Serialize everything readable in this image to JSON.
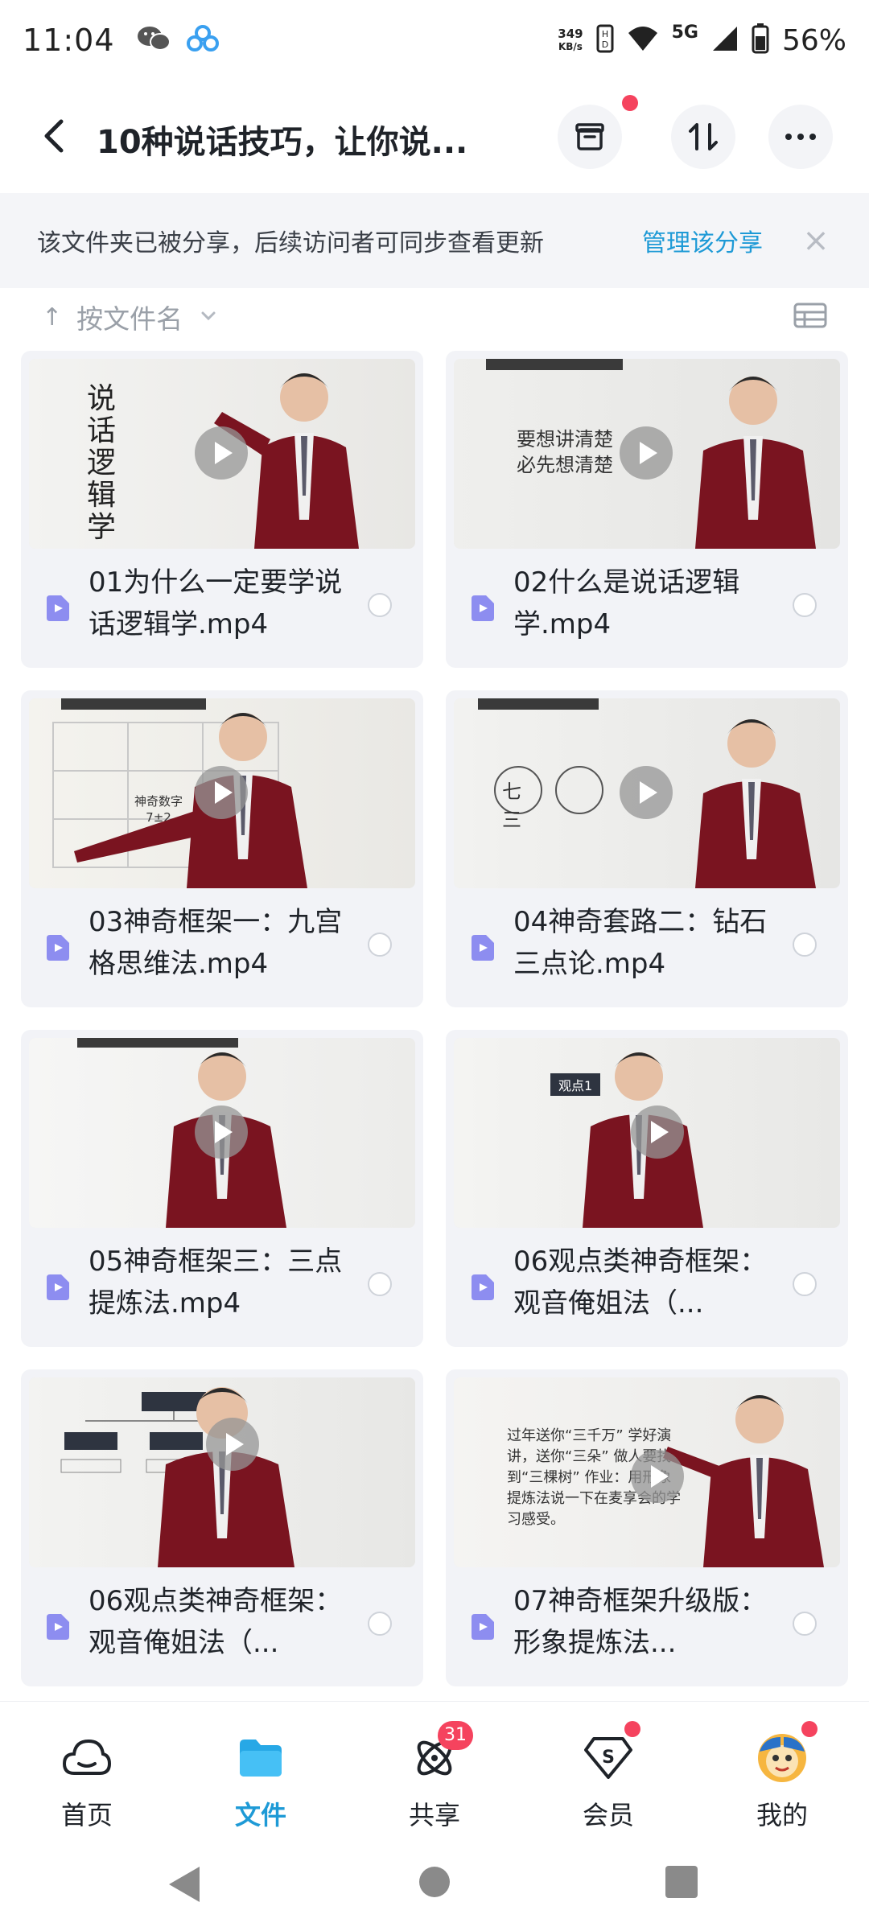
{
  "status_bar": {
    "time": "11:04",
    "speed_value": "349",
    "speed_unit": "KB/s",
    "network": "5G",
    "battery": "56%"
  },
  "header": {
    "title": "10种说话技巧，让你说..."
  },
  "share_banner": {
    "text": "该文件夹已被分享，后续访问者可同步查看更新",
    "manage_link": "管理该分享",
    "close": "×"
  },
  "sort": {
    "arrow": "↑",
    "label": "按文件名"
  },
  "files": [
    {
      "name": "01为什么一定要学说话逻辑学.mp4",
      "thumb_caption": "说话逻辑学"
    },
    {
      "name": "02什么是说话逻辑学.mp4",
      "thumb_caption": "要想讲清楚 必先想清楚"
    },
    {
      "name": "03神奇框架一：九宫格思维法.mp4",
      "thumb_caption": "神奇数字 7±2"
    },
    {
      "name": "04神奇套路二：钻石三点论.mp4",
      "thumb_caption": "七 三"
    },
    {
      "name": "05神奇框架三：三点提炼法.mp4",
      "thumb_caption": ""
    },
    {
      "name": "06观点类神奇框架：观音俺姐法（...",
      "thumb_caption": "观点1"
    },
    {
      "name": "06观点类神奇框架：观音俺姐法（...",
      "thumb_caption": ""
    },
    {
      "name": "07神奇框架升级版：形象提炼法...",
      "thumb_caption": "过年送你“三千万” 学好演讲，送你“三朵” 做人要找到“三棵树” 作业：用形象提炼法说一下在麦享会的学习感受。"
    }
  ],
  "bottom_nav": {
    "items": [
      {
        "label": "首页",
        "active": false
      },
      {
        "label": "文件",
        "active": true
      },
      {
        "label": "共享",
        "active": false,
        "badge": "31"
      },
      {
        "label": "会员",
        "active": false
      },
      {
        "label": "我的",
        "active": false
      }
    ]
  },
  "colors": {
    "accent": "#1e9ad6",
    "badge": "#f5435e",
    "card_bg": "#f2f3f7",
    "suit": "#7a1420"
  }
}
